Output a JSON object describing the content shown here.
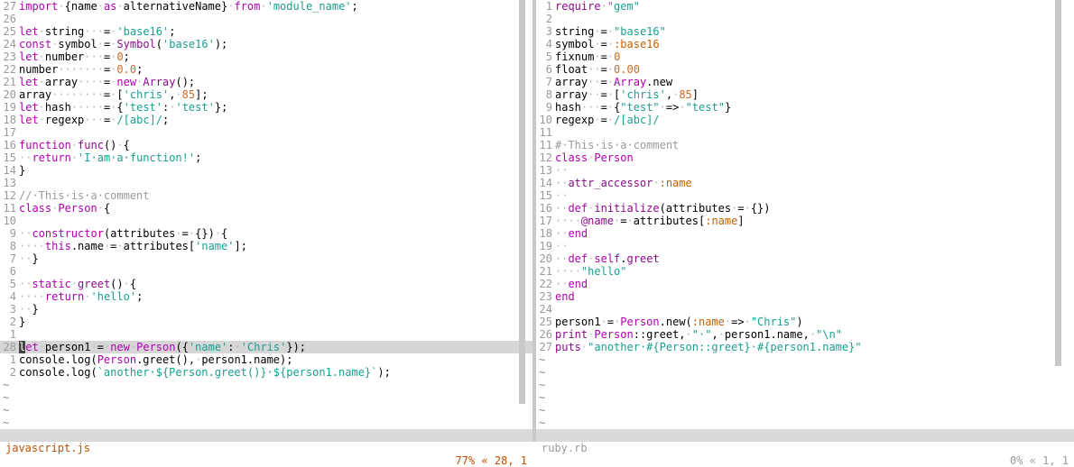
{
  "left": {
    "lines": [
      {
        "n": "27",
        "html": "<span class='kw'>import</span><span class='ws'>·</span>{name<span class='ws'>·</span><span class='kw'>as</span><span class='ws'>·</span>alternativeName}<span class='ws'>·</span><span class='kw'>from</span><span class='ws'>·</span><span class='str'>'module_name'</span>;"
      },
      {
        "n": "26",
        "html": ""
      },
      {
        "n": "25",
        "html": "<span class='kw'>let</span><span class='ws'>·</span>string<span class='ws'>···</span>=<span class='ws'>·</span><span class='str'>'base16'</span>;"
      },
      {
        "n": "24",
        "html": "<span class='kw'>const</span><span class='ws'>·</span>symbol<span class='ws'>·</span>=<span class='ws'>·</span><span class='fn'>Symbol</span>(<span class='str'>'base16'</span>);"
      },
      {
        "n": "23",
        "html": "<span class='kw'>let</span><span class='ws'>·</span>number<span class='ws'>···</span>=<span class='ws'>·</span><span class='num'>0</span>;"
      },
      {
        "n": "22",
        "html": "number<span class='ws'>·······</span>=<span class='ws'>·</span><span class='num'>0.0</span>;"
      },
      {
        "n": "21",
        "html": "<span class='kw'>let</span><span class='ws'>·</span>array<span class='ws'>····</span>=<span class='ws'>·</span><span class='kw'>new</span><span class='ws'>·</span><span class='fn'>Array</span>();"
      },
      {
        "n": "20",
        "html": "array<span class='ws'>········</span>=<span class='ws'>·</span>[<span class='str'>'chris'</span>,<span class='ws'>·</span><span class='num'>85</span>];"
      },
      {
        "n": "19",
        "html": "<span class='kw'>let</span><span class='ws'>·</span>hash<span class='ws'>·····</span>=<span class='ws'>·</span>{<span class='str'>'test'</span>:<span class='ws'>·</span><span class='str'>'test'</span>};"
      },
      {
        "n": "18",
        "html": "<span class='kw'>let</span><span class='ws'>·</span>regexp<span class='ws'>···</span>=<span class='ws'>·</span><span class='rx'>/[abc]/</span>;"
      },
      {
        "n": "17",
        "html": ""
      },
      {
        "n": "16",
        "html": "<span class='kw'>function</span><span class='ws'>·</span><span class='fn'>func</span>()<span class='ws'>·</span>{"
      },
      {
        "n": "15",
        "html": "<span class='ws'>··</span><span class='kw'>return</span><span class='ws'>·</span><span class='str'>'I·am·a·function!'</span>;"
      },
      {
        "n": "14",
        "html": "}"
      },
      {
        "n": "13",
        "html": ""
      },
      {
        "n": "12",
        "html": "<span class='cm'>//·This·is·a·comment</span>"
      },
      {
        "n": "11",
        "html": "<span class='kw'>class</span><span class='ws'>·</span><span class='cls'>Person</span><span class='ws'>·</span>{"
      },
      {
        "n": "10",
        "html": ""
      },
      {
        "n": "9",
        "html": "<span class='ws'>··</span><span class='kw'>constructor</span>(attributes<span class='ws'>·</span>=<span class='ws'>·</span>{})<span class='ws'>·</span>{"
      },
      {
        "n": "8",
        "html": "<span class='ws'>····</span><span class='kw'>this</span>.name<span class='ws'>·</span>=<span class='ws'>·</span>attributes[<span class='str'>'name'</span>];"
      },
      {
        "n": "7",
        "html": "<span class='ws'>··</span>}"
      },
      {
        "n": "6",
        "html": ""
      },
      {
        "n": "5",
        "html": "<span class='ws'>··</span><span class='kw'>static</span><span class='ws'>·</span><span class='fn'>greet</span>()<span class='ws'>·</span>{"
      },
      {
        "n": "4",
        "html": "<span class='ws'>····</span><span class='kw'>return</span><span class='ws'>·</span><span class='str'>'hello'</span>;"
      },
      {
        "n": "3",
        "html": "<span class='ws'>··</span>}"
      },
      {
        "n": "2",
        "html": "}"
      },
      {
        "n": "1",
        "html": ""
      },
      {
        "n": "28",
        "html": "<span class='cursor'>l</span><span class='kw'>et</span><span class='ws'>·</span>person1<span class='ws'>·</span>=<span class='ws'>·</span><span class='kw'>new</span><span class='ws'>·</span><span class='cls'>Person</span>({<span class='str'>'name'</span>:<span class='ws'>·</span><span class='str'>'Chris'</span>});",
        "current": true
      },
      {
        "n": "1",
        "html": "console.log(<span class='cls'>Person</span>.greet(),<span class='ws'>·</span>person1.name);"
      },
      {
        "n": "2",
        "html": "console.log(<span class='str'>`another·${Person.greet()}·${person1.name}`</span>);"
      }
    ],
    "tildes": 4,
    "status": {
      "file": "javascript.js",
      "pos": "77% « 28, 1"
    }
  },
  "right": {
    "lines": [
      {
        "n": "1",
        "html": "<span class='fn'>require</span><span class='ws'>·</span><span class='str'>\"gem\"</span>"
      },
      {
        "n": "2",
        "html": ""
      },
      {
        "n": "3",
        "html": "string<span class='ws'>·</span>=<span class='ws'>·</span><span class='str'>\"base16\"</span>"
      },
      {
        "n": "4",
        "html": "symbol<span class='ws'>·</span>=<span class='ws'>·</span><span class='sym'>:base16</span>"
      },
      {
        "n": "5",
        "html": "fixnum<span class='ws'>·</span>=<span class='ws'>·</span><span class='num'>0</span>"
      },
      {
        "n": "6",
        "html": "float<span class='ws'>··</span>=<span class='ws'>·</span><span class='num'>0.00</span>"
      },
      {
        "n": "7",
        "html": "array<span class='ws'>··</span>=<span class='ws'>·</span><span class='cls'>Array</span>.new"
      },
      {
        "n": "8",
        "html": "array<span class='ws'>··</span>=<span class='ws'>·</span>[<span class='str'>'chris'</span>,<span class='ws'>·</span><span class='num'>85</span>]"
      },
      {
        "n": "9",
        "html": "hash<span class='ws'>···</span>=<span class='ws'>·</span>{<span class='str'>\"test\"</span><span class='ws'>·</span>=&gt;<span class='ws'>·</span><span class='str'>\"test\"</span>}"
      },
      {
        "n": "10",
        "html": "regexp<span class='ws'>·</span>=<span class='ws'>·</span><span class='rx'>/[abc]/</span>"
      },
      {
        "n": "11",
        "html": ""
      },
      {
        "n": "11",
        "html": "<span class='cm'>#·This·is·a·comment</span>"
      },
      {
        "n": "12",
        "html": "<span class='kw'>class</span><span class='ws'>·</span><span class='cls'>Person</span>"
      },
      {
        "n": "13",
        "html": "<span class='ws'>··</span>"
      },
      {
        "n": "14",
        "html": "<span class='ws'>··</span><span class='fn'>attr_accessor</span><span class='ws'>·</span><span class='sym'>:name</span>"
      },
      {
        "n": "15",
        "html": "<span class='ws'>··</span>"
      },
      {
        "n": "16",
        "html": "<span class='ws'>··</span><span class='kw'>def</span><span class='ws'>·</span><span class='fn'>initialize</span>(attributes<span class='ws'>·</span>=<span class='ws'>·</span>{})"
      },
      {
        "n": "17",
        "html": "<span class='ws'>····</span><span class='ivar'>@name</span><span class='ws'>·</span>=<span class='ws'>·</span>attributes[<span class='sym'>:name</span>]"
      },
      {
        "n": "18",
        "html": "<span class='ws'>··</span><span class='kw'>end</span>"
      },
      {
        "n": "19",
        "html": "<span class='ws'>··</span>"
      },
      {
        "n": "20",
        "html": "<span class='ws'>··</span><span class='kw'>def</span><span class='ws'>·</span><span class='kw'>self</span>.<span class='fn'>greet</span>"
      },
      {
        "n": "21",
        "html": "<span class='ws'>····</span><span class='str'>\"hello\"</span>"
      },
      {
        "n": "22",
        "html": "<span class='ws'>··</span><span class='kw'>end</span>"
      },
      {
        "n": "23",
        "html": "<span class='kw'>end</span>"
      },
      {
        "n": "24",
        "html": ""
      },
      {
        "n": "25",
        "html": "person1<span class='ws'>·</span>=<span class='ws'>·</span><span class='cls'>Person</span>.new(<span class='sym'>:name</span><span class='ws'>·</span>=&gt;<span class='ws'>·</span><span class='str'>\"Chris\"</span>)"
      },
      {
        "n": "26",
        "html": "<span class='fn'>print</span><span class='ws'>·</span><span class='cls'>Person</span>::greet,<span class='ws'>·</span><span class='str'>\"·\"</span>,<span class='ws'>·</span>person1.name,<span class='ws'>·</span><span class='str'>\"\\n\"</span>"
      },
      {
        "n": "27",
        "html": "<span class='fn'>puts</span><span class='ws'>·</span><span class='str'>\"another·#{Person::greet}·#{person1.name}\"</span>"
      }
    ],
    "tildes": 6,
    "status": {
      "file": "ruby.rb",
      "pos": "0% « 1, 1"
    }
  }
}
